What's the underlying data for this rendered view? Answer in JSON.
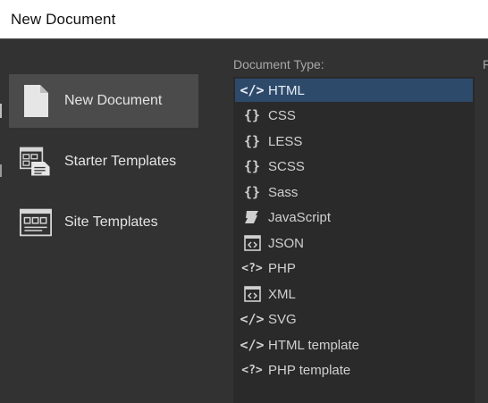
{
  "window": {
    "title": "New Document"
  },
  "sidebar": {
    "items": [
      {
        "label": "New Document",
        "icon": "document-icon",
        "active": true
      },
      {
        "label": "Starter Templates",
        "icon": "starter-templates-icon",
        "active": false
      },
      {
        "label": "Site Templates",
        "icon": "site-templates-icon",
        "active": false
      }
    ]
  },
  "document_type": {
    "label": "Document Type:",
    "selected": "HTML",
    "items": [
      {
        "label": "HTML",
        "icon": "code-tag-icon",
        "glyph": "</>"
      },
      {
        "label": "CSS",
        "icon": "curly-braces-icon",
        "glyph": "{}"
      },
      {
        "label": "LESS",
        "icon": "curly-braces-icon",
        "glyph": "{}"
      },
      {
        "label": "SCSS",
        "icon": "curly-braces-icon",
        "glyph": "{}"
      },
      {
        "label": "Sass",
        "icon": "curly-braces-icon",
        "glyph": "{}"
      },
      {
        "label": "JavaScript",
        "icon": "javascript-scroll-icon",
        "glyph": ""
      },
      {
        "label": "JSON",
        "icon": "json-box-icon",
        "glyph": "<>"
      },
      {
        "label": "PHP",
        "icon": "php-tag-icon",
        "glyph": "<?>"
      },
      {
        "label": "XML",
        "icon": "xml-box-icon",
        "glyph": "<>"
      },
      {
        "label": "SVG",
        "icon": "code-tag-icon",
        "glyph": "</>"
      },
      {
        "label": "HTML template",
        "icon": "code-tag-icon",
        "glyph": "</>"
      },
      {
        "label": "PHP template",
        "icon": "php-tag-icon",
        "glyph": "<?>"
      }
    ]
  },
  "right_panel": {
    "label_fragment": "F"
  },
  "colors": {
    "selection": "#2e4a6b",
    "sidebar_active": "#4b4b4b",
    "background": "#323232",
    "list_bg": "#2a2a2a"
  }
}
